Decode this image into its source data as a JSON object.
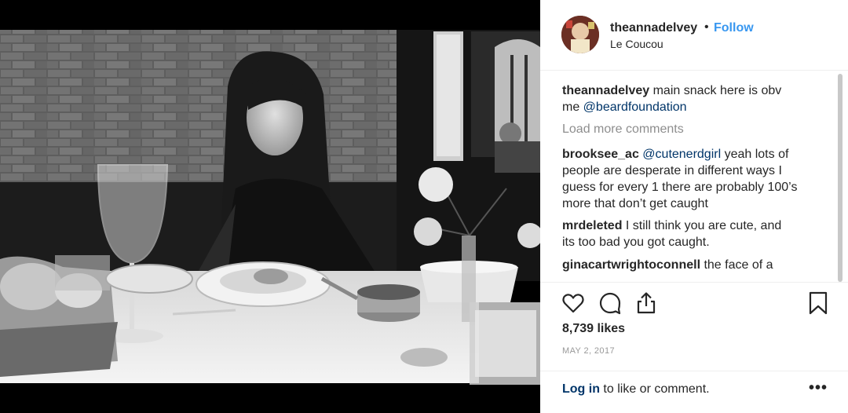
{
  "header": {
    "username": "theannadelvey",
    "separator": "•",
    "follow_label": "Follow",
    "location": "Le Coucou"
  },
  "caption": {
    "username": "theannadelvey",
    "text_line1": " main snack here is obv",
    "text_line2": "me ",
    "mention": "@beardfoundation"
  },
  "load_more": "Load more comments",
  "comments": [
    {
      "username": "brooksee_ac",
      "mention": "@cutenerdgirl",
      "line1_rest": " yeah lots of",
      "line2": "people are desperate in different ways I",
      "line3": "guess for every 1 there are probably 100’s",
      "line4": "more that don’t get caught"
    },
    {
      "username": "mrdeleted",
      "line1_rest": " I still think you are cute, and",
      "line2": "its too bad you got caught."
    },
    {
      "username": "ginacartwrightoconnell",
      "line1_rest": " the face of a"
    }
  ],
  "icons": {
    "like": "heart-icon",
    "comment": "comment-bubble-icon",
    "share": "share-upload-icon",
    "save": "bookmark-icon",
    "more": "ellipsis-icon"
  },
  "likes": "8,739 likes",
  "date": "MAY 2, 2017",
  "login": {
    "link": "Log in",
    "rest": " to like or comment."
  },
  "more_label": "•••",
  "colors": {
    "link_blue": "#3897f0",
    "mention_navy": "#003569",
    "muted_gray": "#8e8e8e",
    "text_dark": "#262626"
  }
}
